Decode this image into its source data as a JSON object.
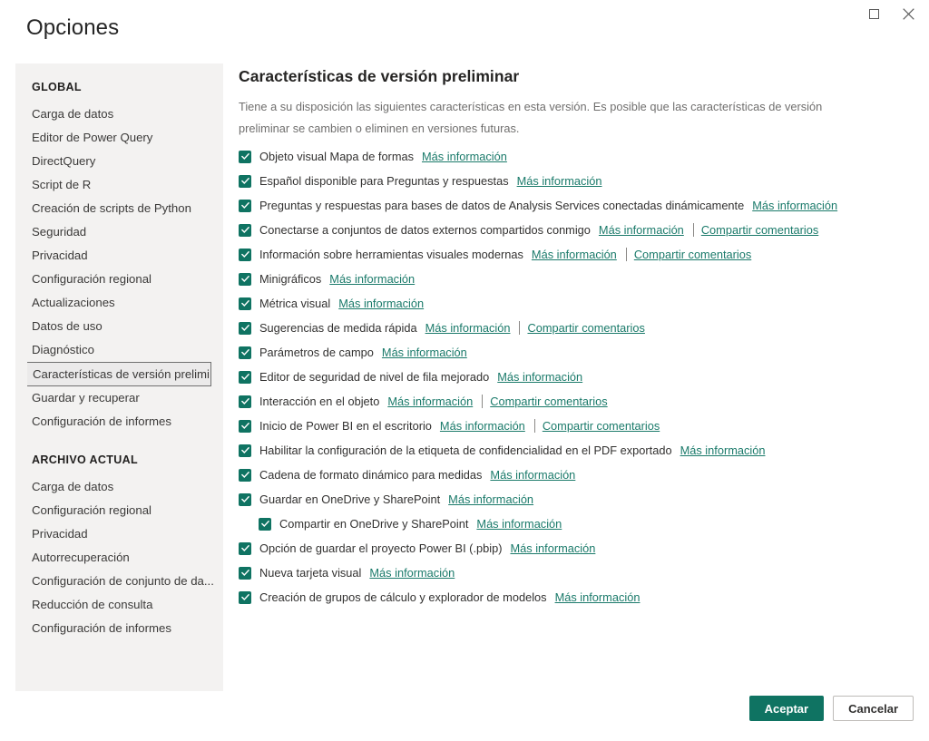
{
  "window": {
    "title": "Opciones",
    "controls": [
      {
        "name": "maximize-button",
        "icon": "maximize-icon"
      },
      {
        "name": "close-button",
        "icon": "close-icon"
      }
    ]
  },
  "colors": {
    "accent_green": "#0f7362",
    "link_teal": "#1a7a6a",
    "sidebar_bg": "#f3f2f1",
    "text_primary": "#323130",
    "text_muted": "#706f6e"
  },
  "sidebar": {
    "groups": [
      {
        "label": "GLOBAL",
        "items": [
          {
            "label": "Carga de datos",
            "selected": false
          },
          {
            "label": "Editor de Power Query",
            "selected": false
          },
          {
            "label": "DirectQuery",
            "selected": false
          },
          {
            "label": "Script de R",
            "selected": false
          },
          {
            "label": "Creación de scripts de Python",
            "selected": false
          },
          {
            "label": "Seguridad",
            "selected": false
          },
          {
            "label": "Privacidad",
            "selected": false
          },
          {
            "label": "Configuración regional",
            "selected": false
          },
          {
            "label": "Actualizaciones",
            "selected": false
          },
          {
            "label": "Datos de uso",
            "selected": false
          },
          {
            "label": "Diagnóstico",
            "selected": false
          },
          {
            "label": "Características de versión prelimi...",
            "selected": true
          },
          {
            "label": "Guardar y recuperar",
            "selected": false
          },
          {
            "label": "Configuración de informes",
            "selected": false
          }
        ]
      },
      {
        "label": "ARCHIVO ACTUAL",
        "items": [
          {
            "label": "Carga de datos",
            "selected": false
          },
          {
            "label": "Configuración regional",
            "selected": false
          },
          {
            "label": "Privacidad",
            "selected": false
          },
          {
            "label": "Autorrecuperación",
            "selected": false
          },
          {
            "label": "Configuración de conjunto de da...",
            "selected": false
          },
          {
            "label": "Reducción de consulta",
            "selected": false
          },
          {
            "label": "Configuración de informes",
            "selected": false
          }
        ]
      }
    ]
  },
  "main": {
    "title": "Características de versión preliminar",
    "description": "Tiene a su disposición las siguientes características en esta versión. Es posible que las características de versión preliminar se cambien o eliminen en versiones futuras.",
    "link_more_info": "Más información",
    "link_share_feedback": "Compartir comentarios",
    "features": [
      {
        "label": "Objeto visual Mapa de formas",
        "checked": true,
        "nested": false,
        "more_info": true,
        "feedback": false
      },
      {
        "label": "Español disponible para Preguntas y respuestas",
        "checked": true,
        "nested": false,
        "more_info": true,
        "feedback": false
      },
      {
        "label": "Preguntas y respuestas para bases de datos de Analysis Services conectadas dinámicamente",
        "checked": true,
        "nested": false,
        "more_info": true,
        "feedback": false
      },
      {
        "label": "Conectarse a conjuntos de datos externos compartidos conmigo",
        "checked": true,
        "nested": false,
        "more_info": true,
        "feedback": true
      },
      {
        "label": "Información sobre herramientas visuales modernas",
        "checked": true,
        "nested": false,
        "more_info": true,
        "feedback": true
      },
      {
        "label": "Minigráficos",
        "checked": true,
        "nested": false,
        "more_info": true,
        "feedback": false
      },
      {
        "label": "Métrica visual",
        "checked": true,
        "nested": false,
        "more_info": true,
        "feedback": false
      },
      {
        "label": "Sugerencias de medida rápida",
        "checked": true,
        "nested": false,
        "more_info": true,
        "feedback": true
      },
      {
        "label": "Parámetros de campo",
        "checked": true,
        "nested": false,
        "more_info": true,
        "feedback": false
      },
      {
        "label": "Editor de seguridad de nivel de fila mejorado",
        "checked": true,
        "nested": false,
        "more_info": true,
        "feedback": false
      },
      {
        "label": "Interacción en el objeto",
        "checked": true,
        "nested": false,
        "more_info": true,
        "feedback": true
      },
      {
        "label": "Inicio de Power BI en el escritorio",
        "checked": true,
        "nested": false,
        "more_info": true,
        "feedback": true
      },
      {
        "label": "Habilitar la configuración de la etiqueta de confidencialidad en el PDF exportado",
        "checked": true,
        "nested": false,
        "more_info": true,
        "feedback": false
      },
      {
        "label": "Cadena de formato dinámico para medidas",
        "checked": true,
        "nested": false,
        "more_info": true,
        "feedback": false
      },
      {
        "label": "Guardar en OneDrive y SharePoint",
        "checked": true,
        "nested": false,
        "more_info": true,
        "feedback": false
      },
      {
        "label": "Compartir en OneDrive y SharePoint",
        "checked": true,
        "nested": true,
        "more_info": true,
        "feedback": false
      },
      {
        "label": "Opción de guardar el proyecto Power BI (.pbip)",
        "checked": true,
        "nested": false,
        "more_info": true,
        "feedback": false
      },
      {
        "label": "Nueva tarjeta visual",
        "checked": true,
        "nested": false,
        "more_info": true,
        "feedback": false
      },
      {
        "label": "Creación de grupos de cálculo y explorador de modelos",
        "checked": true,
        "nested": false,
        "more_info": true,
        "feedback": false
      }
    ]
  },
  "footer": {
    "accept_label": "Aceptar",
    "cancel_label": "Cancelar"
  }
}
